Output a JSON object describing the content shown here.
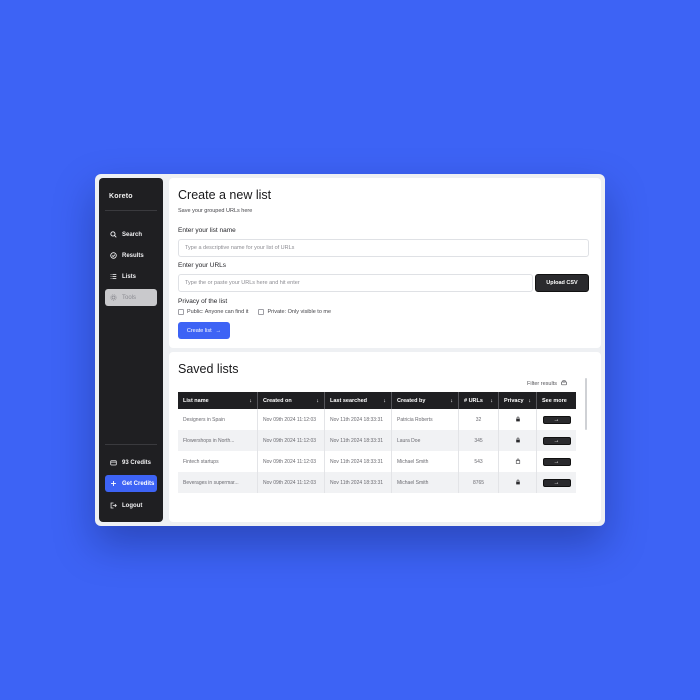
{
  "app": {
    "brand": "Koreto"
  },
  "sidebar": {
    "items": [
      {
        "label": "Search",
        "icon": "search-icon"
      },
      {
        "label": "Results",
        "icon": "check-circle-icon"
      },
      {
        "label": "Lists",
        "icon": "list-icon"
      },
      {
        "label": "Tools",
        "icon": "tools-icon",
        "active": true
      }
    ],
    "credits_label": "93 Credits",
    "get_credits_label": "Get Credits",
    "logout_label": "Logout"
  },
  "create": {
    "title": "Create a new list",
    "subtitle": "Save your grouped URLs here",
    "name_label": "Enter your list name",
    "name_placeholder": "Type a descriptive name for your list of URLs",
    "urls_label": "Enter your URLs",
    "urls_placeholder": "Type the or paste your URLs here and hit enter",
    "upload_label": "Upload CSV",
    "privacy_label": "Privacy of the list",
    "public_option": "Public: Anyone can find it",
    "private_option": "Private: Only visible to me",
    "create_button": "Create list",
    "create_arrow": "→"
  },
  "saved": {
    "title": "Saved lists",
    "filter_label": "Filter results",
    "columns": [
      "List name",
      "Created on",
      "Last searched",
      "Created by",
      "# URLs",
      "Privacy",
      "See more"
    ],
    "sort_arrow": "↓",
    "rows": [
      {
        "name": "Designers in Spain",
        "created": "Nov 09th 2024 11:12:03",
        "searched": "Nov 11th 2024 18:33:31",
        "by": "Patricia Roberts",
        "urls": "32",
        "privacy": "locked"
      },
      {
        "name": "Flowershops in North...",
        "created": "Nov 09th 2024 11:12:03",
        "searched": "Nov 11th 2024 18:33:31",
        "by": "Laura Doe",
        "urls": "345",
        "privacy": "locked"
      },
      {
        "name": "Fintech startups",
        "created": "Nov 09th 2024 11:12:03",
        "searched": "Nov 11th 2024 18:33:31",
        "by": "Michael Smith",
        "urls": "543",
        "privacy": "unlocked"
      },
      {
        "name": "Beverages in supermar...",
        "created": "Nov 09th 2024 11:12:03",
        "searched": "Nov 11th 2024 18:33:31",
        "by": "Michael Smith",
        "urls": "8765",
        "privacy": "locked"
      }
    ],
    "see_more_arrow": "→"
  },
  "colors": {
    "accent": "#3d63f5",
    "sidebar": "#1f1f22",
    "background": "#3d63f5"
  }
}
